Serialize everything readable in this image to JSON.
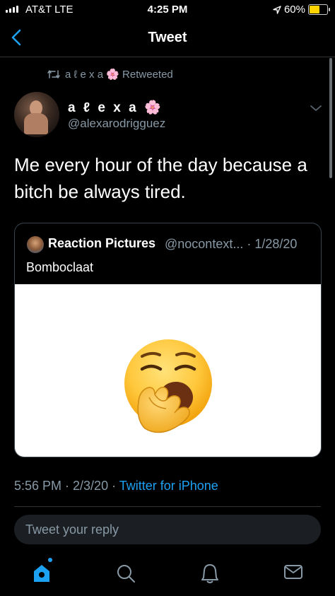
{
  "status_bar": {
    "carrier": "AT&T  LTE",
    "time": "4:25 PM",
    "battery": "60%"
  },
  "nav": {
    "title": "Tweet"
  },
  "retweet": {
    "text": "a ℓ e x a 🌸 Retweeted"
  },
  "author": {
    "name": "a ℓ e x a 🌸",
    "handle": "@alexarodrigguez"
  },
  "tweet": {
    "text": "Me every hour of the day because a bitch be always tired."
  },
  "quote": {
    "name": "Reaction Pictures",
    "handle_date": "@nocontext... · 1/28/20",
    "text": "Bomboclaat"
  },
  "meta": {
    "time_date": "5:56 PM · 2/3/20 · ",
    "source": "Twitter for iPhone"
  },
  "reply": {
    "placeholder": "Tweet your reply"
  },
  "colors": {
    "accent": "#1da1f2",
    "muted": "#8899a6",
    "background": "#000000"
  },
  "tabs": [
    "home-icon",
    "search-icon",
    "notifications-icon",
    "messages-icon"
  ]
}
